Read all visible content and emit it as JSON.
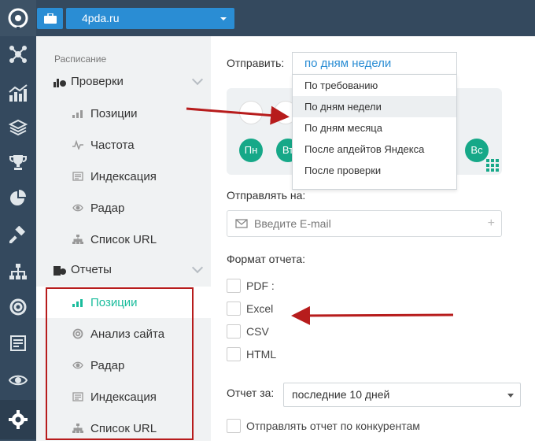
{
  "header": {
    "site": "4pda.ru"
  },
  "sidebar": {
    "section_label": "Расписание",
    "group_checks": "Проверки",
    "checks": [
      "Позиции",
      "Частота",
      "Индексация",
      "Радар",
      "Список URL"
    ],
    "group_reports": "Отчеты",
    "reports": [
      "Позиции",
      "Анализ сайта",
      "Радар",
      "Индексация",
      "Список URL"
    ]
  },
  "main": {
    "send_label": "Отправить:",
    "send_value": "по дням недели",
    "send_options": [
      "По требованию",
      "По дням недели",
      "По дням месяца",
      "После апдейтов Яндекса",
      "После проверки"
    ],
    "days": [
      "Пн",
      "Вт",
      "Вс"
    ],
    "send_to_label": "Отправлять на:",
    "email_placeholder": "Введите E-mail",
    "format_label": "Формат отчета:",
    "formats": [
      "PDF :",
      "Excel",
      "CSV",
      "HTML"
    ],
    "period_label": "Отчет за:",
    "period_value": "последние 10 дней",
    "competitors_label": "Отправлять отчет по конкурентам"
  },
  "colors": {
    "accent": "#1abc9c",
    "day": "#16a888",
    "topbar": "#34495e",
    "button": "#2a8dd4",
    "annotation": "#b71c1c"
  }
}
